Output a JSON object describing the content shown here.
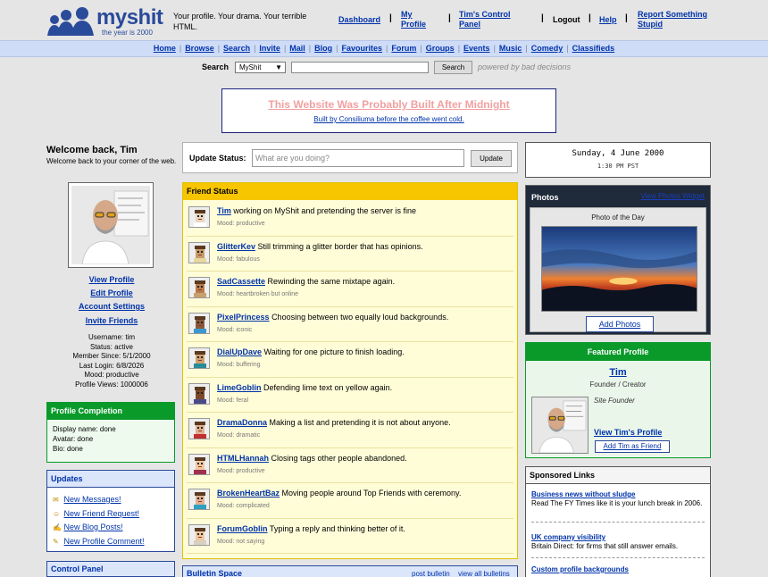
{
  "brand": {
    "name": "myshit",
    "tagline": "the year is 2000",
    "logo_color": "#2a4a9a"
  },
  "header": {
    "blurb": "Your profile. Your drama. Your terrible HTML.",
    "nav": [
      "Dashboard",
      "My Profile",
      "Tim's Control Panel",
      "Logout",
      "Help",
      "Report Something Stupid"
    ]
  },
  "mainnav": [
    "Home",
    "Browse",
    "Search",
    "Invite",
    "Mail",
    "Blog",
    "Favourites",
    "Forum",
    "Groups",
    "Events",
    "Music",
    "Comedy",
    "Classifieds"
  ],
  "search": {
    "label": "Search",
    "scope": "MyShit",
    "value": "",
    "button": "Search",
    "powered": "powered by bad decisions"
  },
  "banner": {
    "title": "This Website Was Probably Built After Midnight",
    "subtitle": "Built by Consiliuma before the coffee went cold."
  },
  "profile": {
    "welcome_title": "Welcome back, Tim",
    "welcome_text": "Welcome back to your corner of the web.",
    "links": [
      "View Profile",
      "Edit Profile",
      "Account Settings",
      "Invite Friends"
    ],
    "stats": [
      "Username: tim",
      "Status: active",
      "Member Since: 5/1/2000",
      "Last Login: 6/8/2026",
      "Mood: productive",
      "Profile Views: 1000006"
    ]
  },
  "completion": {
    "title": "Profile Completion",
    "lines": [
      "Display name: done",
      "Avatar: done",
      "Bio: done"
    ]
  },
  "updates": {
    "title": "Updates",
    "items": [
      {
        "icon": "envelope-icon",
        "glyph": "✉",
        "label": "New Messages!"
      },
      {
        "icon": "smiley-icon",
        "glyph": "☺",
        "label": "New Friend Request!"
      },
      {
        "icon": "pencil-icon",
        "glyph": "✍",
        "label": "New Blog Posts!"
      },
      {
        "icon": "comment-icon",
        "glyph": "✎",
        "label": "New Profile Comment!"
      }
    ]
  },
  "controlpanel": {
    "title": "Control Panel"
  },
  "status_update": {
    "label": "Update Status:",
    "placeholder": "What are you doing?",
    "button": "Update"
  },
  "friend_status": {
    "title": "Friend Status",
    "items": [
      {
        "name": "Tim",
        "text": "working on MyShit and pretending the server is fine",
        "mood": "Mood: productive",
        "avatar_color": "#e8d6c0",
        "shirt": "#ffffff"
      },
      {
        "name": "GlitterKev",
        "text": "Still trimming a glitter border that has opinions.",
        "mood": "Mood: fabulous",
        "avatar_color": "#c89a6a",
        "shirt": "#e6d6a0"
      },
      {
        "name": "SadCassette",
        "text": "Rewinding the same mixtape again.",
        "mood": "Mood: heartbroken but online",
        "avatar_color": "#b87a4a",
        "shirt": "#c8a070"
      },
      {
        "name": "PixelPrincess",
        "text": "Choosing between two equally loud backgrounds.",
        "mood": "Mood: iconic",
        "avatar_color": "#8a5a3a",
        "shirt": "#3a9ad0"
      },
      {
        "name": "DialUpDave",
        "text": "Waiting for one picture to finish loading.",
        "mood": "Mood: buffering",
        "avatar_color": "#d0a070",
        "shirt": "#2a8a9a"
      },
      {
        "name": "LimeGoblin",
        "text": "Defending lime text on yellow again.",
        "mood": "Mood: feral",
        "avatar_color": "#7a4a2a",
        "shirt": "#4a4a8a"
      },
      {
        "name": "DramaDonna",
        "text": "Making a list and pretending it is not about anyone.",
        "mood": "Mood: dramatic",
        "avatar_color": "#e0b090",
        "shirt": "#c03030"
      },
      {
        "name": "HTMLHannah",
        "text": "Closing tags other people abandoned.",
        "mood": "Mood: productive",
        "avatar_color": "#f0c8a0",
        "shirt": "#a03050"
      },
      {
        "name": "BrokenHeartBaz",
        "text": "Moving people around Top Friends with ceremony.",
        "mood": "Mood: complicated",
        "avatar_color": "#e0b090",
        "shirt": "#30a0c0"
      },
      {
        "name": "ForumGoblin",
        "text": "Typing a reply and thinking better of it.",
        "mood": "Mood: not saying",
        "avatar_color": "#f0c8a0",
        "shirt": "#d8d0c0"
      }
    ]
  },
  "bulletin": {
    "title": "Bulletin Space",
    "post": "post bulletin",
    "view": "view all bulletins"
  },
  "date": {
    "day": "Sunday, 4 June 2000",
    "time": "1:30 PM PST"
  },
  "photos": {
    "title": "Photos",
    "view_link": "View Photos Widget",
    "potd": "Photo of the Day",
    "add": "Add Photos"
  },
  "featured": {
    "title": "Featured Profile",
    "name": "Tim",
    "role": "Founder / Creator",
    "tag": "Site Founder",
    "view": "View Tim's Profile",
    "add": "Add Tim as Friend"
  },
  "sponsored": {
    "title": "Sponsored Links",
    "ads": [
      {
        "title": "Business news without sludge",
        "text": "Read The FY Times like it is your lunch break in 2006."
      },
      {
        "title": "UK company visibility",
        "text": "Britain Direct: for firms that still answer emails."
      },
      {
        "title": "Custom profile backgrounds",
        "text": ""
      }
    ]
  }
}
